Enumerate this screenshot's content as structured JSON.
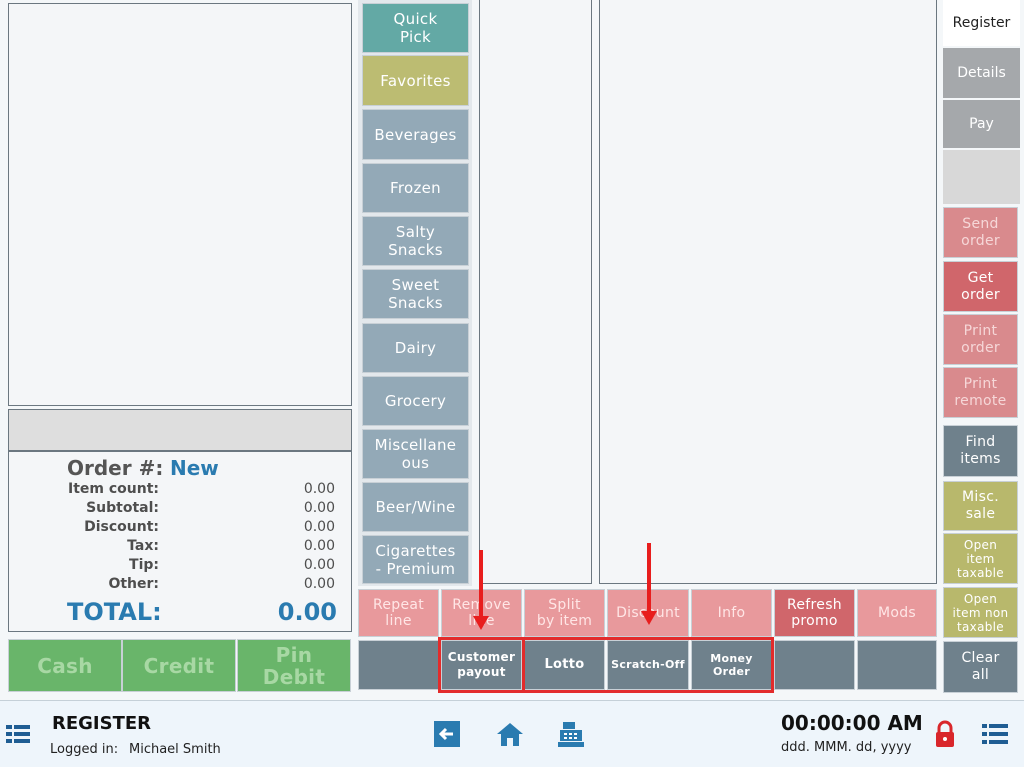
{
  "categories": [
    {
      "label": "Quick\nPick"
    },
    {
      "label": "Favorites"
    },
    {
      "label": "Beverages"
    },
    {
      "label": "Frozen"
    },
    {
      "label": "Salty\nSnacks"
    },
    {
      "label": "Sweet\nSnacks"
    },
    {
      "label": "Dairy"
    },
    {
      "label": "Grocery"
    },
    {
      "label": "Miscellane\nous"
    },
    {
      "label": "Beer/Wine"
    },
    {
      "label": "Cigarettes\n- Premium"
    }
  ],
  "tabs": {
    "register": "Register",
    "details": "Details",
    "pay": "Pay"
  },
  "side_actions": {
    "send_order": "Send\norder",
    "get_order": "Get\norder",
    "print_order": "Print\norder",
    "print_remote": "Print\nremote",
    "find_items": "Find\nitems",
    "misc_sale": "Misc.\nsale",
    "open_item_taxable": "Open\nitem\ntaxable",
    "open_item_non_taxable": "Open\nitem non\ntaxable",
    "clear_all": "Clear\nall"
  },
  "line_actions": {
    "repeat_line": "Repeat\nline",
    "remove_line": "Remove\nline",
    "split_by_item": "Split\nby item",
    "discount": "Discount",
    "info": "Info",
    "refresh_promo": "Refresh\npromo",
    "mods": "Mods"
  },
  "special_actions": {
    "customer_payout": "Customer\npayout",
    "lotto": "Lotto",
    "scratch_off": "Scratch-Off",
    "money_order": "Money\nOrder"
  },
  "order": {
    "label": "Order #:",
    "status": "New",
    "rows": [
      {
        "label": "Item count:",
        "value": "0.00"
      },
      {
        "label": "Subtotal:",
        "value": "0.00"
      },
      {
        "label": "Discount:",
        "value": "0.00"
      },
      {
        "label": "Tax:",
        "value": "0.00"
      },
      {
        "label": "Tip:",
        "value": "0.00"
      },
      {
        "label": "Other:",
        "value": "0.00"
      }
    ],
    "total_label": "TOTAL:",
    "total_value": "0.00"
  },
  "payments": {
    "cash": "Cash",
    "credit": "Credit",
    "pin_debit": "Pin\nDebit"
  },
  "status_bar": {
    "title": "REGISTER",
    "logged_in_label": "Logged in:",
    "user": "Michael Smith",
    "time": "00:00:00 AM",
    "date_format": "ddd. MMM. dd, yyyy"
  },
  "icons": {
    "menu": "menu-icon",
    "back": "back-arrow-icon",
    "home": "home-icon",
    "register": "cash-register-icon",
    "lock": "lock-icon",
    "list": "list-icon"
  },
  "colors": {
    "category": "#93a9b7",
    "red_action": "#d0666b",
    "slate_action": "#6f818c",
    "olive_action": "#b8b86c",
    "green_payment": "#69b56a",
    "highlight": "#e32b2b",
    "accent_blue": "#2a7bb0"
  }
}
